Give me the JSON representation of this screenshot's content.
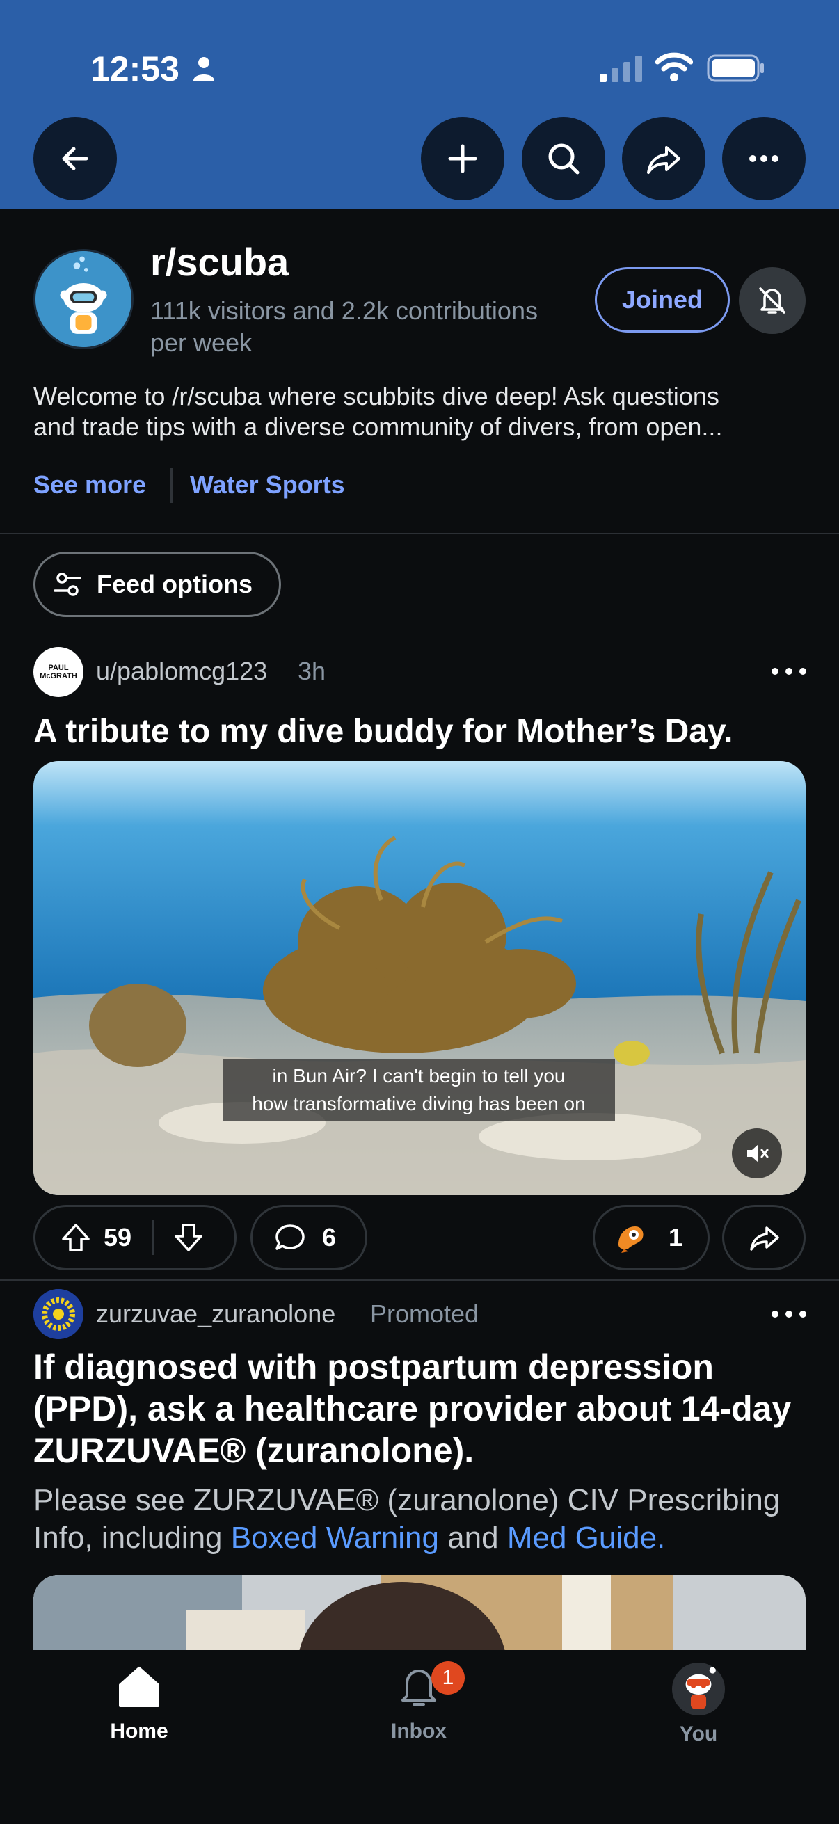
{
  "status_bar": {
    "time": "12:53"
  },
  "subreddit": {
    "name": "r/scuba",
    "stats": "111k visitors and 2.2k contributions per week",
    "joined_label": "Joined",
    "description_line1": "Welcome to /r/scuba where scubbits dive deep! Ask questions",
    "description_line2": "and trade tips with a diverse community of divers, from open...",
    "see_more": "See more",
    "topic": "Water Sports"
  },
  "feed_options_label": "Feed options",
  "post": {
    "avatar_text": "PAUL McGRATH",
    "user": "u/pablomcg123",
    "time": "3h",
    "title": "A tribute to my dive buddy for Mother’s Day.",
    "caption_line1": "in Bun Air? I can't begin to tell you",
    "caption_line2": "how transformative diving has been on",
    "upvotes": "59",
    "comments": "6",
    "awards": "1"
  },
  "ad": {
    "user": "zurzuvae_zuranolone",
    "promoted": "Promoted",
    "title": "If diagnosed with postpartum depression (PPD), ask a healthcare provider about 14-day ZURZUVAE® (zuranolone).",
    "body_prefix": "Please see ZURZUVAE® (zuranolone) CIV Prescribing Info, including ",
    "link1": "Boxed Warning",
    "body_mid": " and ",
    "link2": "Med Guide."
  },
  "tabs": {
    "home": "Home",
    "inbox": "Inbox",
    "inbox_badge": "1",
    "you": "You"
  },
  "colors": {
    "header_blue": "#2b5fa8",
    "accent": "#7ea2ff",
    "background": "#0b0d0f"
  }
}
